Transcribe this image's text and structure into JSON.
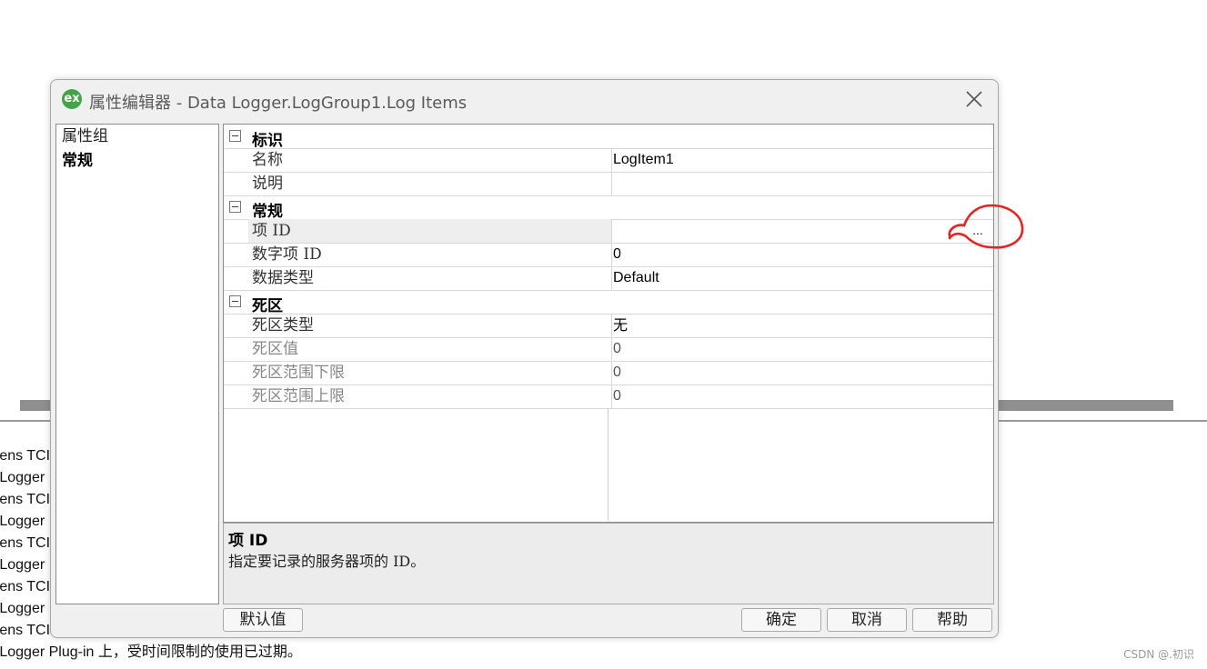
{
  "background": {
    "log_lines": [
      "mens TCI",
      "a Logger",
      "mens TCI",
      "a Logger",
      "mens TCI",
      "a Logger",
      "mens TCI",
      "a Logger",
      "mens TCI",
      "a Logger Plug-in 上，受时间限制的使用已过期。"
    ],
    "watermark": "CSDN @.初识"
  },
  "dialog": {
    "app_icon_text": "ex",
    "title": "属性编辑器 - Data Logger.LogGroup1.Log Items",
    "close_icon": "close-icon"
  },
  "left_panel": {
    "items": [
      "属性组",
      "常规"
    ],
    "selected": "常规"
  },
  "grid": {
    "categories": {
      "identity": "标识",
      "general": "常规",
      "deadband": "死区"
    },
    "rows": {
      "name": {
        "label": "名称",
        "value": "LogItem1"
      },
      "description": {
        "label": "说明",
        "value": ""
      },
      "item_id": {
        "label": "项 ID",
        "value": "",
        "button": "..."
      },
      "numeric_item_id": {
        "label": "数字项 ID",
        "value": "0"
      },
      "data_type": {
        "label": "数据类型",
        "value": "Default"
      },
      "deadband_type": {
        "label": "死区类型",
        "value": "无"
      },
      "deadband_value": {
        "label": "死区值",
        "value": "0"
      },
      "deadband_low": {
        "label": "死区范围下限",
        "value": "0"
      },
      "deadband_high": {
        "label": "死区范围上限",
        "value": "0"
      }
    }
  },
  "description": {
    "title": "项 ID",
    "body": "指定要记录的服务器项的 ID。"
  },
  "buttons": {
    "defaults": "默认值",
    "ok": "确定",
    "cancel": "取消",
    "help": "帮助"
  },
  "colors": {
    "annotation_red": "#e8231f",
    "icon_green": "#45a44a"
  }
}
